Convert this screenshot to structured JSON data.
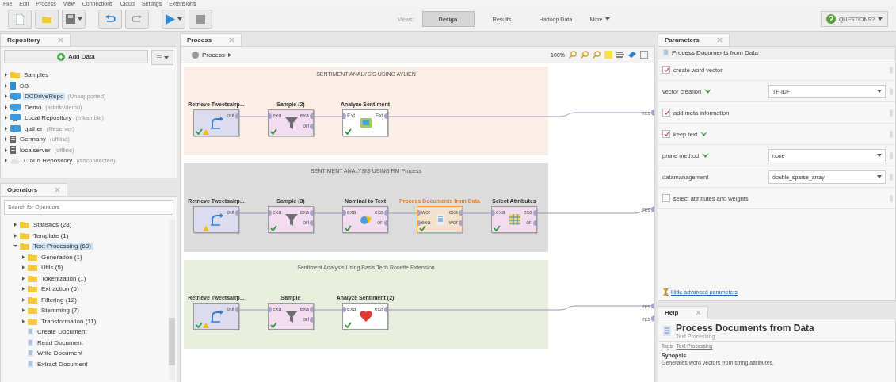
{
  "menu": [
    "File",
    "Edit",
    "Process",
    "View",
    "Connections",
    "Cloud",
    "Settings",
    "Extensions"
  ],
  "toolbar": {
    "views_label": "Views:",
    "views": [
      {
        "label": "Design",
        "selected": true
      },
      {
        "label": "Results",
        "selected": false
      },
      {
        "label": "Hadoop Data",
        "selected": false
      },
      {
        "label": "More",
        "selected": false
      }
    ],
    "account": "QUESTIONS?"
  },
  "repository": {
    "title": "Repository",
    "add_button": "Add Data",
    "items": [
      {
        "kind": "folder",
        "name": "Samples",
        "selected": false
      },
      {
        "kind": "db",
        "name": "DB",
        "selected": false
      },
      {
        "kind": "repo",
        "name": "DCDriveRepo",
        "note": "(Unsupported)",
        "selected": true
      },
      {
        "kind": "repo",
        "name": "Demo",
        "note": "(admin/demo)",
        "selected": false
      },
      {
        "kind": "repo",
        "name": "Local Repository",
        "note": "(mkamble)",
        "selected": false
      },
      {
        "kind": "repo",
        "name": "gather",
        "note": "(fileserver)",
        "selected": false
      },
      {
        "kind": "server",
        "name": "Germany",
        "note": "(offline)",
        "selected": false
      },
      {
        "kind": "server",
        "name": "localserver",
        "note": "(offline)",
        "selected": false
      },
      {
        "kind": "cloud",
        "name": "Cloud Repository",
        "note": "(disconnected)",
        "selected": false
      }
    ]
  },
  "operators": {
    "title": "Operators",
    "search_placeholder": "Search for Operators",
    "items": [
      {
        "kind": "folder",
        "name": "Statistics (28)",
        "expanded": false,
        "selected": false
      },
      {
        "kind": "folder",
        "name": "Template (1)",
        "expanded": false,
        "selected": false
      },
      {
        "kind": "folder",
        "name": "Text Processing (63)",
        "expanded": true,
        "selected": true,
        "children": [
          {
            "kind": "folder",
            "name": "Generation (1)",
            "expanded": false,
            "selected": false
          },
          {
            "kind": "folder",
            "name": "Utils (5)",
            "expanded": false,
            "selected": false
          },
          {
            "kind": "folder",
            "name": "Tokenization (1)",
            "expanded": false,
            "selected": false
          },
          {
            "kind": "folder",
            "name": "Extraction (5)",
            "expanded": false,
            "selected": false
          },
          {
            "kind": "folder",
            "name": "Filtering (12)",
            "expanded": false,
            "selected": false
          },
          {
            "kind": "folder",
            "name": "Stemming (7)",
            "expanded": false,
            "selected": false
          },
          {
            "kind": "folder",
            "name": "Transformation (11)",
            "expanded": false,
            "selected": false
          },
          {
            "kind": "operator",
            "name": "Create Document",
            "selected": false
          },
          {
            "kind": "operator",
            "name": "Read Document",
            "selected": false
          },
          {
            "kind": "operator",
            "name": "Write Document",
            "selected": false
          },
          {
            "kind": "operator",
            "name": "Extract Document",
            "selected": false
          }
        ]
      }
    ]
  },
  "process": {
    "title": "Process",
    "breadcrumb": "Process",
    "zoom": "100%",
    "groups": [
      {
        "title": "SENTIMENT ANALYSIS USING AYLIEN",
        "color": "#fbeee6",
        "nodes": [
          {
            "kind": "retrieve",
            "label": "Retrieve Tweetsairp...",
            "outputs": [
              "out"
            ],
            "ok": true,
            "warning": true,
            "selected": false
          },
          {
            "kind": "sample",
            "label": "Sample (2)",
            "inputs": [
              "exa"
            ],
            "outputs": [
              "exa",
              "ori"
            ],
            "ok": true,
            "warning": false,
            "selected": false
          },
          {
            "kind": "analyze",
            "label": "Analyze Sentiment",
            "inputs": [
              "Ext"
            ],
            "outputs": [
              "Ext"
            ],
            "ok": true,
            "warning": false,
            "selected": false
          }
        ]
      },
      {
        "title": "SENTIMENT ANALYSIS USING RM Process",
        "color": "#dcdcdc",
        "nodes": [
          {
            "kind": "retrieve",
            "label": "Retrieve Tweetsairp...",
            "outputs": [
              "out"
            ],
            "ok": false,
            "warning": true,
            "selected": false
          },
          {
            "kind": "sample",
            "label": "Sample (3)",
            "inputs": [
              "exa"
            ],
            "outputs": [
              "exa",
              "ori"
            ],
            "ok": true,
            "warning": false,
            "selected": false
          },
          {
            "kind": "nominal",
            "label": "Nominal to Text",
            "inputs": [
              "exa"
            ],
            "outputs": [
              "exa",
              "ori"
            ],
            "ok": true,
            "warning": false,
            "selected": false
          },
          {
            "kind": "documents",
            "label": "Process Documents from Data",
            "inputs": [
              "wor",
              "exa"
            ],
            "outputs": [
              "exa",
              "wor"
            ],
            "ok": true,
            "warning": false,
            "selected": true
          },
          {
            "kind": "select",
            "label": "Select Attributes",
            "inputs": [
              "exa"
            ],
            "outputs": [
              "exa",
              "ori"
            ],
            "ok": true,
            "warning": false,
            "selected": false
          }
        ]
      },
      {
        "title": "Sentiment Analysis Using Basis Tech Rosette Extension",
        "color": "#e9efdf",
        "nodes": [
          {
            "kind": "retrieve",
            "label": "Retrieve Tweetsairp...",
            "outputs": [
              "out"
            ],
            "ok": true,
            "warning": true,
            "selected": false
          },
          {
            "kind": "sample",
            "label": "Sample",
            "inputs": [
              "exa"
            ],
            "outputs": [
              "exa",
              "ori"
            ],
            "ok": true,
            "warning": false,
            "selected": false
          },
          {
            "kind": "heart",
            "label": "Analyze Sentiment (2)",
            "inputs": [
              "exa"
            ],
            "outputs": [
              "exa"
            ],
            "ok": true,
            "warning": false,
            "selected": false
          }
        ]
      }
    ],
    "result_ports": [
      "res",
      "res",
      "res",
      "res"
    ]
  },
  "parameters": {
    "title": "Parameters",
    "operator": "Process Documents from Data",
    "rows": [
      {
        "kind": "checkbox",
        "label": "create word vector",
        "checked": true,
        "chevron": false
      },
      {
        "kind": "select",
        "label": "vector creation",
        "value": "TF-IDF",
        "chevron": true
      },
      {
        "kind": "checkbox",
        "label": "add meta information",
        "checked": true,
        "chevron": false
      },
      {
        "kind": "checkbox",
        "label": "keep text",
        "checked": true,
        "chevron": true
      },
      {
        "kind": "select",
        "label": "prune method",
        "value": "none",
        "chevron": true
      },
      {
        "kind": "select",
        "label": "datamanagement",
        "value": "double_sparse_array",
        "chevron": false
      },
      {
        "kind": "checkbox",
        "label": "select attributes and weights",
        "checked": false,
        "chevron": false
      }
    ],
    "link": "Hide advanced parameters"
  },
  "help": {
    "title": "Help",
    "operator": "Process Documents from Data",
    "group": "Text Processing",
    "tags_label": "Tags:",
    "tag": "Text Processing",
    "section": "Synopsis",
    "synopsis": "Generates word vectors from string attributes."
  }
}
